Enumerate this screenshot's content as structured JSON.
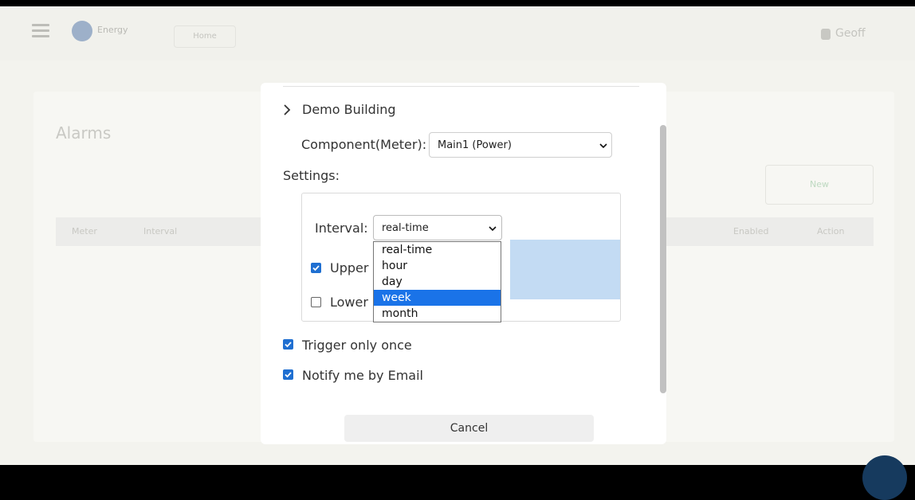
{
  "background_app": {
    "brand": "Energy",
    "nav_button": "Home",
    "user_name": "Geoff",
    "page_title": "Alarms",
    "new_button": "New",
    "table_headers": [
      "Meter",
      "Interval",
      "",
      "Enabled",
      "Action"
    ]
  },
  "modal": {
    "building": "Demo Building",
    "component_label": "Component(Meter):",
    "component_value": "Main1 (Power)",
    "settings_label": "Settings:",
    "interval_label": "Interval:",
    "interval_value": "real-time",
    "interval_options": [
      "real-time",
      "hour",
      "day",
      "week",
      "month"
    ],
    "highlighted_option": "week",
    "upper_label": "Upper",
    "upper_checked": true,
    "lower_label": "Lower",
    "lower_checked": false,
    "trigger_label": "Trigger only once",
    "trigger_checked": true,
    "notify_label": "Notify me by Email",
    "notify_checked": true,
    "cancel_label": "Cancel"
  },
  "colors": {
    "checkbox_accent": "#1f6fd1",
    "option_highlight": "#1a73e8",
    "selection_highlight": "#c3dbf3"
  }
}
